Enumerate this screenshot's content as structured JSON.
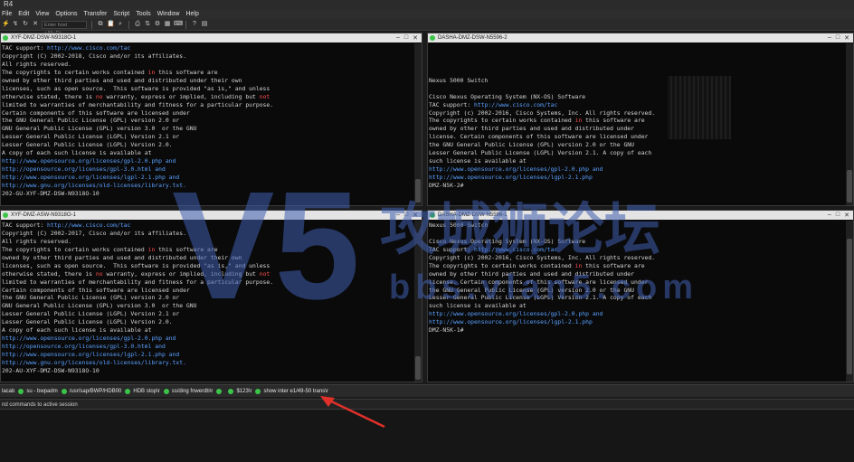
{
  "window": {
    "title": "R4"
  },
  "menu": [
    "File",
    "Edit",
    "View",
    "Options",
    "Transfer",
    "Script",
    "Tools",
    "Window",
    "Help"
  ],
  "toolbar": {
    "host_placeholder": "Enter host <Alt+R>"
  },
  "panels": [
    {
      "title": "XYF-DMZ-DSW-N9318O-1",
      "lines": [
        [
          [
            "TAC support: ",
            ""
          ],
          [
            "http://www.cisco.com/tac",
            "link"
          ]
        ],
        [
          [
            "Copyright (C) 2002-2018, Cisco and/or its affiliates.",
            ""
          ]
        ],
        [
          [
            "All rights reserved.",
            ""
          ]
        ],
        [
          [
            "The copyrights to certain works contained ",
            ""
          ],
          [
            "in",
            "hl"
          ],
          [
            " this software are",
            ""
          ]
        ],
        [
          [
            "owned by other third parties and used and distributed under their own",
            ""
          ]
        ],
        [
          [
            "licenses, such as open source.  This software is provided \"as is,\" and unless",
            ""
          ]
        ],
        [
          [
            "otherwise stated, there is ",
            ""
          ],
          [
            "no",
            "hl"
          ],
          [
            " warranty, express or implied, including but ",
            ""
          ],
          [
            "not",
            "hl"
          ]
        ],
        [
          [
            "limited to warranties of merchantability and fitness for a particular purpose.",
            ""
          ]
        ],
        [
          [
            "Certain components of this software are licensed under",
            ""
          ]
        ],
        [
          [
            "the GNU General Public License (GPL) version 2.0 or",
            ""
          ]
        ],
        [
          [
            "GNU General Public License (GPL) version 3.0  or the GNU",
            ""
          ]
        ],
        [
          [
            "Lesser General Public License (LGPL) Version 2.1 or",
            ""
          ]
        ],
        [
          [
            "Lesser General Public License (LGPL) Version 2.0.",
            ""
          ]
        ],
        [
          [
            "A copy of each such license is available at",
            ""
          ]
        ],
        [
          [
            "http://www.opensource.org/licenses/gpl-2.0.php and",
            "link"
          ]
        ],
        [
          [
            "http://opensource.org/licenses/gpl-3.0.html and",
            "link"
          ]
        ],
        [
          [
            "http://www.opensource.org/licenses/lgpl-2.1.php and",
            "link"
          ]
        ],
        [
          [
            "http://www.gnu.org/licenses/old-licenses/library.txt.",
            "link"
          ]
        ],
        [
          [
            "202-GU-XYF-DMZ-DSW-N9318O-10",
            ""
          ]
        ]
      ]
    },
    {
      "title": "DASHA-DMZ-DSW-N5596-2",
      "lines": [
        [
          [
            "",
            ""
          ]
        ],
        [
          [
            "",
            ""
          ]
        ],
        [
          [
            "",
            ""
          ]
        ],
        [
          [
            "",
            ""
          ]
        ],
        [
          [
            "Nexus 5000 Switch",
            ""
          ]
        ],
        [
          [
            "",
            ""
          ]
        ],
        [
          [
            "Cisco Nexus Operating System (NX-OS) Software",
            ""
          ]
        ],
        [
          [
            "TAC support: ",
            ""
          ],
          [
            "http://www.cisco.com/tac",
            "link"
          ]
        ],
        [
          [
            "Copyright (c) 2002-2016, Cisco Systems, Inc. All rights reserved.",
            ""
          ]
        ],
        [
          [
            "The copyrights to certain works contained ",
            ""
          ],
          [
            "in",
            "hl"
          ],
          [
            " this software are",
            ""
          ]
        ],
        [
          [
            "owned by other third parties and used and distributed under",
            ""
          ]
        ],
        [
          [
            "license. Certain components of this software are licensed under",
            ""
          ]
        ],
        [
          [
            "the GNU General Public License (GPL) version 2.0 or the GNU",
            ""
          ]
        ],
        [
          [
            "Lesser General Public License (LGPL) Version 2.1. A copy of each",
            ""
          ]
        ],
        [
          [
            "such license is available at",
            ""
          ]
        ],
        [
          [
            "http://www.opensource.org/licenses/gpl-2.0.php and",
            "link"
          ]
        ],
        [
          [
            "http://www.opensource.org/licenses/lgpl-2.1.php",
            "link"
          ]
        ],
        [
          [
            "DMZ-N5K-2#",
            ""
          ]
        ]
      ]
    },
    {
      "title": "XYF-DMZ-ASW-N9318O-1",
      "lines": [
        [
          [
            "TAC support: ",
            ""
          ],
          [
            "http://www.cisco.com/tac",
            "link"
          ]
        ],
        [
          [
            "Copyright (C) 2002-2017, Cisco and/or its affiliates.",
            ""
          ]
        ],
        [
          [
            "All rights reserved.",
            ""
          ]
        ],
        [
          [
            "The copyrights to certain works contained ",
            ""
          ],
          [
            "in",
            "hl"
          ],
          [
            " this software are",
            ""
          ]
        ],
        [
          [
            "owned by other third parties and used and distributed under their own",
            ""
          ]
        ],
        [
          [
            "licenses, such as open source.  This software is provided \"as is,\" and unless",
            ""
          ]
        ],
        [
          [
            "otherwise stated, there is ",
            ""
          ],
          [
            "no",
            "hl"
          ],
          [
            " warranty, express or implied, including but ",
            ""
          ],
          [
            "not",
            "hl"
          ]
        ],
        [
          [
            "limited to warranties of merchantability and fitness for a particular purpose.",
            ""
          ]
        ],
        [
          [
            "Certain components of this software are licensed under",
            ""
          ]
        ],
        [
          [
            "the GNU General Public License (GPL) version 2.0 or",
            ""
          ]
        ],
        [
          [
            "GNU General Public License (GPL) version 3.0  or the GNU",
            ""
          ]
        ],
        [
          [
            "Lesser General Public License (LGPL) Version 2.1 or",
            ""
          ]
        ],
        [
          [
            "Lesser General Public License (LGPL) Version 2.0.",
            ""
          ]
        ],
        [
          [
            "A copy of each such license is available at",
            ""
          ]
        ],
        [
          [
            "http://www.opensource.org/licenses/gpl-2.0.php and",
            "link"
          ]
        ],
        [
          [
            "http://opensource.org/licenses/gpl-3.0.html and",
            "link"
          ]
        ],
        [
          [
            "http://www.opensource.org/licenses/lgpl-2.1.php and",
            "link"
          ]
        ],
        [
          [
            "http://www.gnu.org/licenses/old-licenses/library.txt.",
            "link"
          ]
        ],
        [
          [
            "202-AU-XYF-DMZ-DSW-N9318O-10",
            ""
          ]
        ]
      ]
    },
    {
      "title": "DASHA-DMZ-DSW-N5596-1",
      "lines": [
        [
          [
            "Nexus 5000 Switch",
            ""
          ]
        ],
        [
          [
            "",
            ""
          ]
        ],
        [
          [
            "Cisco Nexus Operating System (NX-OS) Software",
            ""
          ]
        ],
        [
          [
            "TAC support: ",
            ""
          ],
          [
            "http://www.cisco.com/tac",
            "link"
          ]
        ],
        [
          [
            "Copyright (c) 2002-2016, Cisco Systems, Inc. All rights reserved.",
            ""
          ]
        ],
        [
          [
            "The copyrights to certain works contained ",
            ""
          ],
          [
            "in",
            "hl"
          ],
          [
            " this software are",
            ""
          ]
        ],
        [
          [
            "owned by other third parties and used and distributed under",
            ""
          ]
        ],
        [
          [
            "license. Certain components of this software are licensed under",
            ""
          ]
        ],
        [
          [
            "the GNU General Public License (GPL) version 2.0 or the GNU",
            ""
          ]
        ],
        [
          [
            "Lesser General Public License (LGPL) Version 2.1. A copy of each",
            ""
          ]
        ],
        [
          [
            "such license is available at",
            ""
          ]
        ],
        [
          [
            "http://www.opensource.org/licenses/gpl-2.0.php and",
            "link"
          ]
        ],
        [
          [
            "http://www.opensource.org/licenses/lgpl-2.1.php",
            "link"
          ]
        ],
        [
          [
            "DMZ-N5K-1#",
            ""
          ]
        ]
      ]
    }
  ],
  "buttonbar": {
    "label": "lacab",
    "buttons": [
      "su - bwpadm",
      "/usr/sap/BWP/HDB00",
      "HDB stop\\r",
      "ss/ding fnwerdb\\r",
      "",
      "$123\\r",
      "show inter e1/49-50 trans\\r"
    ]
  },
  "command_bar": {
    "text": "nd commands to active session"
  },
  "watermark": {
    "big": "V5",
    "cn": "攻城狮论坛",
    "url": "bbs.vlan5.com"
  },
  "colors": {
    "accent_green": "#3cc44a",
    "link": "#5aa0ff",
    "highlight": "#ff4d4d",
    "arrow": "#e0302a"
  }
}
